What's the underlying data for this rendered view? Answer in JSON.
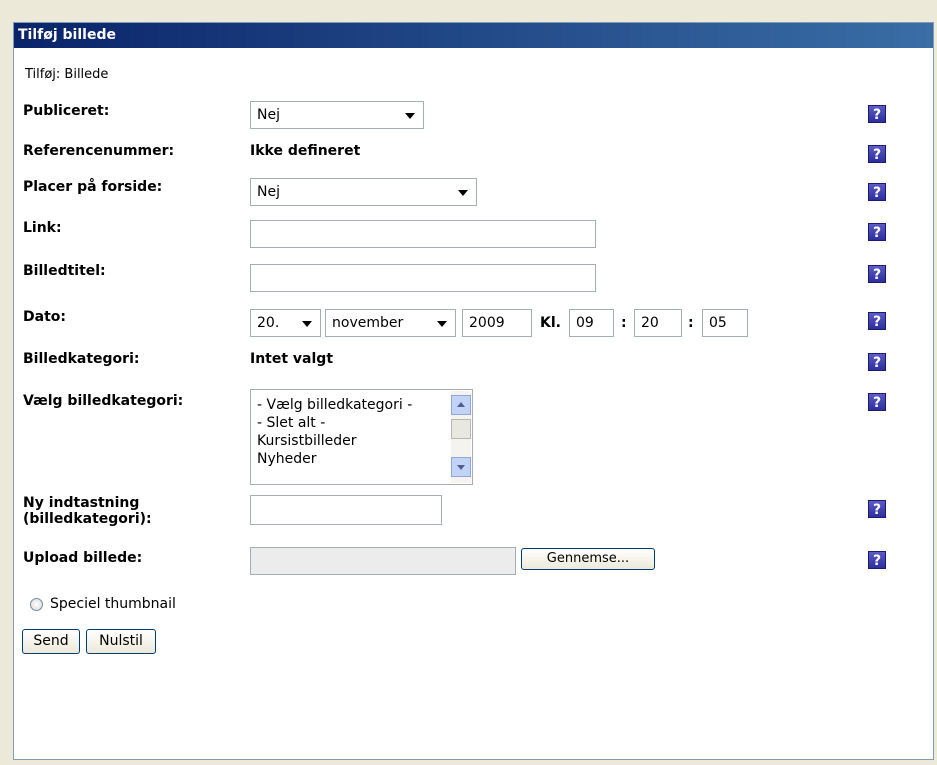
{
  "header": {
    "title": "Tilføj billede"
  },
  "subtitle": "Tilføj: Billede",
  "fields": {
    "publiceret": {
      "label": "Publiceret:",
      "value": "Nej"
    },
    "referencenummer": {
      "label": "Referencenummer:",
      "value": "Ikke defineret"
    },
    "placer_forside": {
      "label": "Placer på forside:",
      "value": "Nej"
    },
    "link": {
      "label": "Link:",
      "value": ""
    },
    "billedtitel": {
      "label": "Billedtitel:",
      "value": ""
    },
    "dato": {
      "label": "Dato:",
      "day": "20.",
      "month": "november",
      "year": "2009",
      "kl_label": "Kl.",
      "hour": "09",
      "minute": "20",
      "second": "05",
      "sep": ":"
    },
    "billedkategori": {
      "label": "Billedkategori:",
      "value": "Intet valgt"
    },
    "vaelg_kategori": {
      "label": "Vælg billedkategori:",
      "options": [
        "- Vælg billedkategori -",
        "- Slet alt -",
        "Kursistbilleder",
        "Nyheder"
      ]
    },
    "ny_indtastning": {
      "label_line1": "Ny indtastning",
      "label_line2": "(billedkategori):",
      "value": ""
    },
    "upload": {
      "label": "Upload billede:",
      "value": "",
      "browse_label": "Gennemse..."
    }
  },
  "thumbnail": {
    "label": "Speciel thumbnail"
  },
  "buttons": {
    "send": "Send",
    "reset": "Nulstil"
  },
  "help_glyph": "?",
  "colors": {
    "titlebar": "#0a246a",
    "help": "#3a3ab0"
  }
}
